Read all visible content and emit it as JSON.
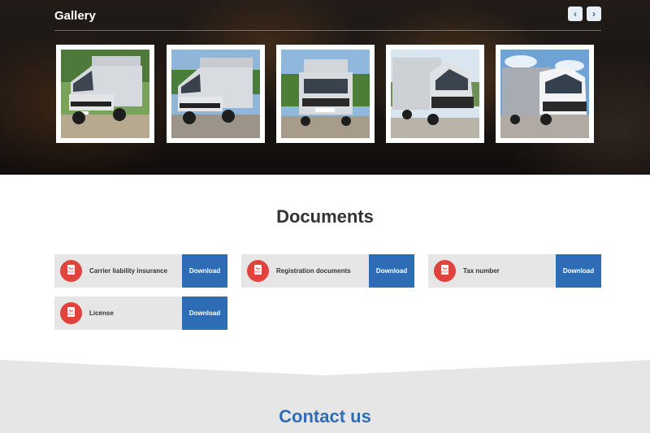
{
  "gallery": {
    "title": "Gallery",
    "prev_icon": "chevron-left-icon",
    "next_icon": "chevron-right-icon",
    "prev_glyph": "‹",
    "next_glyph": "›"
  },
  "documents": {
    "title": "Documents",
    "items": [
      {
        "label": "Carrier liability insurance",
        "button": "Download",
        "icon": "pdf-icon"
      },
      {
        "label": "Registration documents",
        "button": "Download",
        "icon": "pdf-icon"
      },
      {
        "label": "Tax number",
        "button": "Download",
        "icon": "pdf-icon"
      },
      {
        "label": "License",
        "button": "Download",
        "icon": "pdf-icon"
      }
    ]
  },
  "contact": {
    "title": "Contact us"
  },
  "colors": {
    "accent": "#2e6db6",
    "pdf_red": "#e0433b",
    "doc_bg": "#e6e6e6",
    "contact_bg": "#e6e6e6"
  }
}
